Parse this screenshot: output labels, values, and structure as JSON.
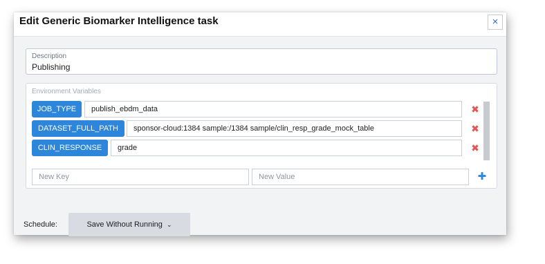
{
  "dialog": {
    "title": "Edit Generic Biomarker Intelligence task",
    "close_icon": "×"
  },
  "description": {
    "label": "Description",
    "value": "Publishing"
  },
  "env": {
    "label": "Environment Variables",
    "variables": [
      {
        "key": "JOB_TYPE",
        "value": "publish_ebdm_data"
      },
      {
        "key": "DATASET_FULL_PATH",
        "value": "sponsor-cloud:1384 sample:/1384 sample/clin_resp_grade_mock_table"
      },
      {
        "key": "CLIN_RESPONSE",
        "value": "grade"
      }
    ],
    "delete_icon": "✖",
    "new_key_placeholder": "New Key",
    "new_value_placeholder": "New Value",
    "add_icon": "✚"
  },
  "schedule": {
    "label": "Schedule:",
    "selected": "Save Without Running",
    "chevron_icon": "⌄"
  },
  "colors": {
    "key_pill": "#2d86d9",
    "delete": "#e25555",
    "body_bg": "#f1f3f5",
    "schedule_btn": "#d8dce2"
  }
}
